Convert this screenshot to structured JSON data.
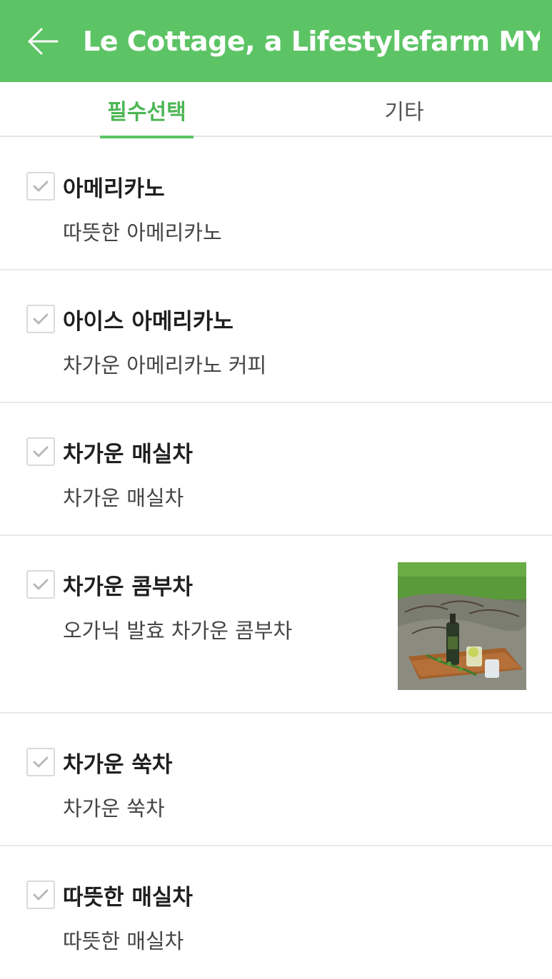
{
  "header": {
    "title": "Le Cottage, a Lifestylefarm MY",
    "back_icon": "arrow-left-icon",
    "background_color": "#5dc465"
  },
  "tabs": [
    {
      "label": "필수선택",
      "active": true
    },
    {
      "label": "기타",
      "active": false
    }
  ],
  "menu_items": [
    {
      "name": "아메리카노",
      "description": "따뜻한 아메리카노",
      "checked": true
    },
    {
      "name": "아이스 아메리카노",
      "description": "차가운 아메리카노 커피",
      "checked": true
    },
    {
      "name": "차가운 매실차",
      "description": "차가운 매실차",
      "checked": true
    },
    {
      "name": "차가운 콤부차",
      "description": "오가닉 발효 차가운 콤부차",
      "checked": true,
      "has_image": true
    },
    {
      "name": "차가운 쑥차",
      "description": "차가운 쑥차",
      "checked": true
    },
    {
      "name": "따뜻한 매실차",
      "description": "따뜻한 매실차",
      "checked": true
    }
  ]
}
